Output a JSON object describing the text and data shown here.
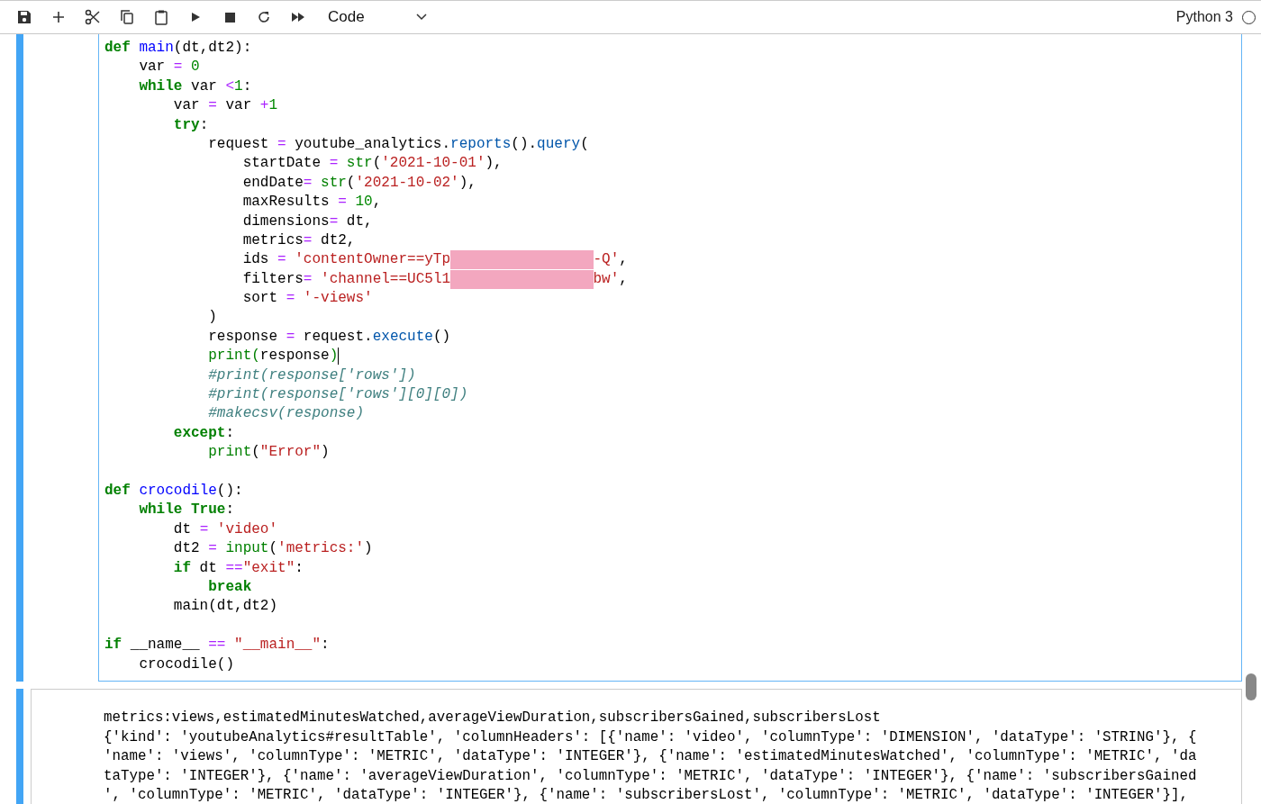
{
  "toolbar": {
    "cell_type": "Code",
    "kernel": {
      "name": "Python 3",
      "busy": false
    }
  },
  "code_lines": [
    [
      {
        "kind": "kw",
        "text": "def"
      },
      {
        "kind": "fn",
        "text": " main"
      },
      {
        "kind": "p",
        "text": "(dt,dt2):"
      }
    ],
    [
      {
        "kind": "p",
        "text": "    var "
      },
      {
        "kind": "op",
        "text": "="
      },
      {
        "kind": "num",
        "text": " 0"
      }
    ],
    [
      {
        "kind": "kw",
        "text": "    while"
      },
      {
        "kind": "p",
        "text": " var "
      },
      {
        "kind": "op",
        "text": "<"
      },
      {
        "kind": "num",
        "text": "1"
      },
      {
        "kind": "p",
        "text": ":"
      }
    ],
    [
      {
        "kind": "p",
        "text": "        var "
      },
      {
        "kind": "op",
        "text": "="
      },
      {
        "kind": "p",
        "text": " var "
      },
      {
        "kind": "op",
        "text": "+"
      },
      {
        "kind": "num",
        "text": "1"
      }
    ],
    [
      {
        "kind": "kw",
        "text": "        try"
      },
      {
        "kind": "p",
        "text": ":"
      }
    ],
    [
      {
        "kind": "p",
        "text": "            request "
      },
      {
        "kind": "op",
        "text": "="
      },
      {
        "kind": "p",
        "text": " youtube_analytics."
      },
      {
        "kind": "call",
        "text": "reports"
      },
      {
        "kind": "p",
        "text": "()."
      },
      {
        "kind": "call",
        "text": "query"
      },
      {
        "kind": "p",
        "text": "("
      }
    ],
    [
      {
        "kind": "p",
        "text": "                startDate "
      },
      {
        "kind": "op",
        "text": "="
      },
      {
        "kind": "bi",
        "text": " str"
      },
      {
        "kind": "p",
        "text": "("
      },
      {
        "kind": "str",
        "text": "'2021-10-01'"
      },
      {
        "kind": "p",
        "text": "),"
      }
    ],
    [
      {
        "kind": "p",
        "text": "                endDate"
      },
      {
        "kind": "op",
        "text": "="
      },
      {
        "kind": "bi",
        "text": " str"
      },
      {
        "kind": "p",
        "text": "("
      },
      {
        "kind": "str",
        "text": "'2021-10-02'"
      },
      {
        "kind": "p",
        "text": "),"
      }
    ],
    [
      {
        "kind": "p",
        "text": "                maxResults "
      },
      {
        "kind": "op",
        "text": "="
      },
      {
        "kind": "num",
        "text": " 10"
      },
      {
        "kind": "p",
        "text": ","
      }
    ],
    [
      {
        "kind": "p",
        "text": "                dimensions"
      },
      {
        "kind": "op",
        "text": "="
      },
      {
        "kind": "p",
        "text": " dt,"
      }
    ],
    [
      {
        "kind": "p",
        "text": "                metrics"
      },
      {
        "kind": "op",
        "text": "="
      },
      {
        "kind": "p",
        "text": " dt2,"
      }
    ],
    [
      {
        "kind": "p",
        "text": "                ids "
      },
      {
        "kind": "op",
        "text": "="
      },
      {
        "kind": "str",
        "text": " 'contentOwner==yTp"
      },
      {
        "kind": "redaction"
      },
      {
        "kind": "str",
        "text": "-Q'"
      },
      {
        "kind": "p",
        "text": ","
      }
    ],
    [
      {
        "kind": "p",
        "text": "                filters"
      },
      {
        "kind": "op",
        "text": "="
      },
      {
        "kind": "str",
        "text": " 'channel==UC5l1"
      },
      {
        "kind": "redaction"
      },
      {
        "kind": "str",
        "text": "bw'"
      },
      {
        "kind": "p",
        "text": ","
      }
    ],
    [
      {
        "kind": "p",
        "text": "                sort "
      },
      {
        "kind": "op",
        "text": "="
      },
      {
        "kind": "str",
        "text": " '-views'"
      }
    ],
    [
      {
        "kind": "p",
        "text": "            )"
      }
    ],
    [
      {
        "kind": "p",
        "text": "            response "
      },
      {
        "kind": "op",
        "text": "="
      },
      {
        "kind": "p",
        "text": " request."
      },
      {
        "kind": "call",
        "text": "execute"
      },
      {
        "kind": "p",
        "text": "()"
      }
    ],
    [
      {
        "kind": "bi",
        "text": "            print("
      },
      {
        "kind": "p",
        "text": "response"
      },
      {
        "kind": "bi",
        "text": ")"
      },
      {
        "kind": "cursor"
      }
    ],
    [
      {
        "kind": "cm",
        "text": "            #print(response['rows'])"
      }
    ],
    [
      {
        "kind": "cm",
        "text": "            #print(response['rows'][0][0])"
      }
    ],
    [
      {
        "kind": "cm",
        "text": "            #makecsv(response)"
      }
    ],
    [
      {
        "kind": "kw",
        "text": "        except"
      },
      {
        "kind": "p",
        "text": ":"
      }
    ],
    [
      {
        "kind": "bi",
        "text": "            print"
      },
      {
        "kind": "p",
        "text": "("
      },
      {
        "kind": "str",
        "text": "\"Error\""
      },
      {
        "kind": "p",
        "text": ")"
      }
    ],
    [
      {
        "kind": "gap"
      },
      {
        "kind": "kw",
        "text": "def"
      },
      {
        "kind": "fn",
        "text": " crocodile"
      },
      {
        "kind": "p",
        "text": "():"
      }
    ],
    [
      {
        "kind": "kw",
        "text": "    while True"
      },
      {
        "kind": "p",
        "text": ":"
      }
    ],
    [
      {
        "kind": "p",
        "text": "        dt "
      },
      {
        "kind": "op",
        "text": "="
      },
      {
        "kind": "str",
        "text": " 'video'"
      }
    ],
    [
      {
        "kind": "p",
        "text": "        dt2 "
      },
      {
        "kind": "op",
        "text": "="
      },
      {
        "kind": "bi",
        "text": " input"
      },
      {
        "kind": "p",
        "text": "("
      },
      {
        "kind": "str",
        "text": "'metrics:'"
      },
      {
        "kind": "p",
        "text": ")"
      }
    ],
    [
      {
        "kind": "kw",
        "text": "        if"
      },
      {
        "kind": "p",
        "text": " dt "
      },
      {
        "kind": "op",
        "text": "=="
      },
      {
        "kind": "str",
        "text": "\"exit\""
      },
      {
        "kind": "p",
        "text": ":"
      }
    ],
    [
      {
        "kind": "kw",
        "text": "            break"
      }
    ],
    [
      {
        "kind": "p",
        "text": "        main(dt,dt2)"
      }
    ],
    [
      {
        "kind": "gap"
      },
      {
        "kind": "kw",
        "text": "if"
      },
      {
        "kind": "p",
        "text": " __name__ "
      },
      {
        "kind": "op",
        "text": "=="
      },
      {
        "kind": "str",
        "text": " \"__main__\""
      },
      {
        "kind": "p",
        "text": ":"
      }
    ],
    [
      {
        "kind": "p",
        "text": "    crocodile()"
      }
    ]
  ],
  "output_lines": [
    "metrics:views,estimatedMinutesWatched,averageViewDuration,subscribersGained,subscribersLost",
    "{'kind': 'youtubeAnalytics#resultTable', 'columnHeaders': [{'name': 'video', 'columnType': 'DIMENSION', 'dataType': 'STRING'}, {",
    "'name': 'views', 'columnType': 'METRIC', 'dataType': 'INTEGER'}, {'name': 'estimatedMinutesWatched', 'columnType': 'METRIC', 'da",
    "taType': 'INTEGER'}, {'name': 'averageViewDuration', 'columnType': 'METRIC', 'dataType': 'INTEGER'}, {'name': 'subscribersGained",
    "', 'columnType': 'METRIC', 'dataType': 'INTEGER'}, {'name': 'subscribersLost', 'columnType': 'METRIC', 'dataType': 'INTEGER'}],"
  ]
}
